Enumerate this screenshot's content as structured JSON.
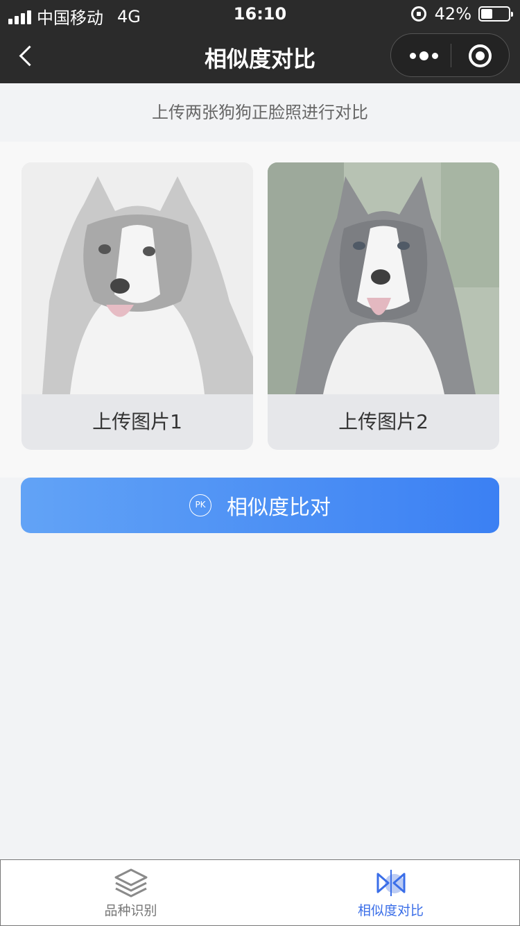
{
  "status_bar": {
    "carrier": "中国移动",
    "network": "4G",
    "time": "16:10",
    "battery": "42%",
    "battery_level": 0.42
  },
  "nav": {
    "title": "相似度对比"
  },
  "subtitle": "上传两张狗狗正脸照进行对比",
  "uploads": [
    {
      "label": "上传图片1"
    },
    {
      "label": "上传图片2"
    }
  ],
  "compare_button": {
    "icon_text": "PK",
    "label": "相似度比对"
  },
  "tabs": [
    {
      "label": "品种识别",
      "icon": "layers-icon",
      "active": false
    },
    {
      "label": "相似度对比",
      "icon": "compare-icon",
      "active": true
    }
  ],
  "colors": {
    "accent": "#3a6ee8",
    "button_gradient_start": "#62a3f6",
    "button_gradient_end": "#3b80f3",
    "nav_background": "#2b2b2b"
  }
}
